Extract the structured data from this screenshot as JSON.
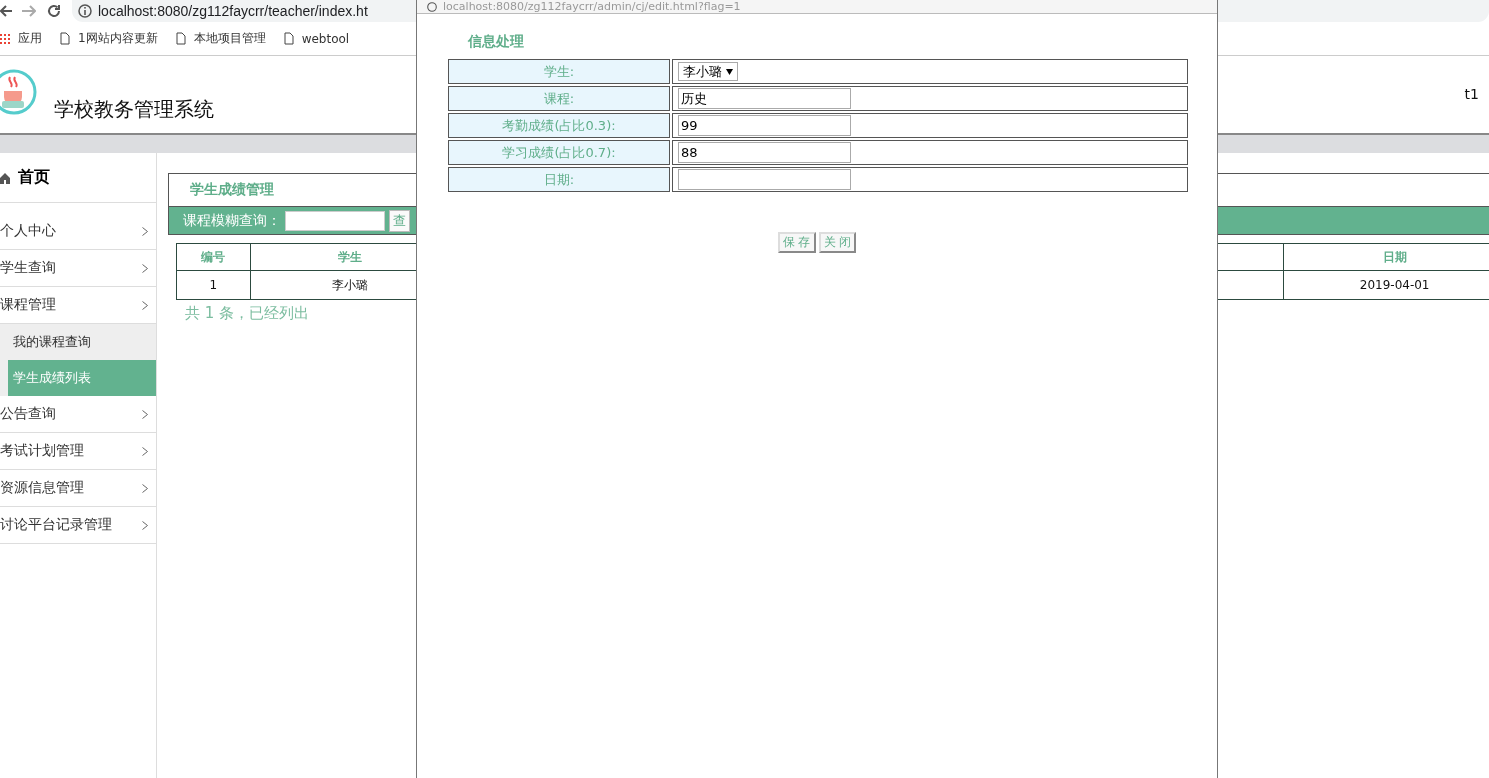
{
  "browser": {
    "url": "localhost:8080/zg112faycrr/teacher/index.ht",
    "bookmarks": [
      {
        "label": "应用",
        "kind": "apps"
      },
      {
        "label": "1网站内容更新",
        "kind": "page"
      },
      {
        "label": "本地项目管理",
        "kind": "page"
      },
      {
        "label": "webtool",
        "kind": "page"
      }
    ]
  },
  "header": {
    "title": "学校教务管理系统",
    "user": "t1"
  },
  "sidebar": {
    "home": "首页",
    "items": [
      {
        "label": "个人中心"
      },
      {
        "label": "学生查询"
      },
      {
        "label": "课程管理",
        "children": [
          {
            "label": "我的课程查询",
            "selected": false
          },
          {
            "label": "学生成绩列表",
            "selected": true
          }
        ]
      },
      {
        "label": "公告查询"
      },
      {
        "label": "考试计划管理"
      },
      {
        "label": "资源信息管理"
      },
      {
        "label": "讨论平台记录管理"
      }
    ]
  },
  "main": {
    "title": "学生成绩管理",
    "search": {
      "label": "课程模糊查询：",
      "button": "查"
    },
    "table": {
      "columns": [
        "编号",
        "学生",
        "日期"
      ],
      "rows": [
        [
          "1",
          "李小璐",
          "2019-04-01"
        ]
      ]
    },
    "footer": "共 1 条，已经列出"
  },
  "popup": {
    "url": "localhost:8080/zg112faycrr/admin/cj/edit.html?flag=1",
    "title": "信息处理",
    "fields": [
      {
        "kind": "select",
        "label": "学生:",
        "value": "李小璐"
      },
      {
        "kind": "text",
        "label": "课程:",
        "value": "历史"
      },
      {
        "kind": "text",
        "label": "考勤成绩(占比0.3):",
        "value": "99"
      },
      {
        "kind": "text",
        "label": "学习成绩(占比0.7):",
        "value": "88"
      },
      {
        "kind": "text",
        "label": "日期:"
      }
    ],
    "buttons": [
      "保 存",
      "关 闭"
    ]
  }
}
